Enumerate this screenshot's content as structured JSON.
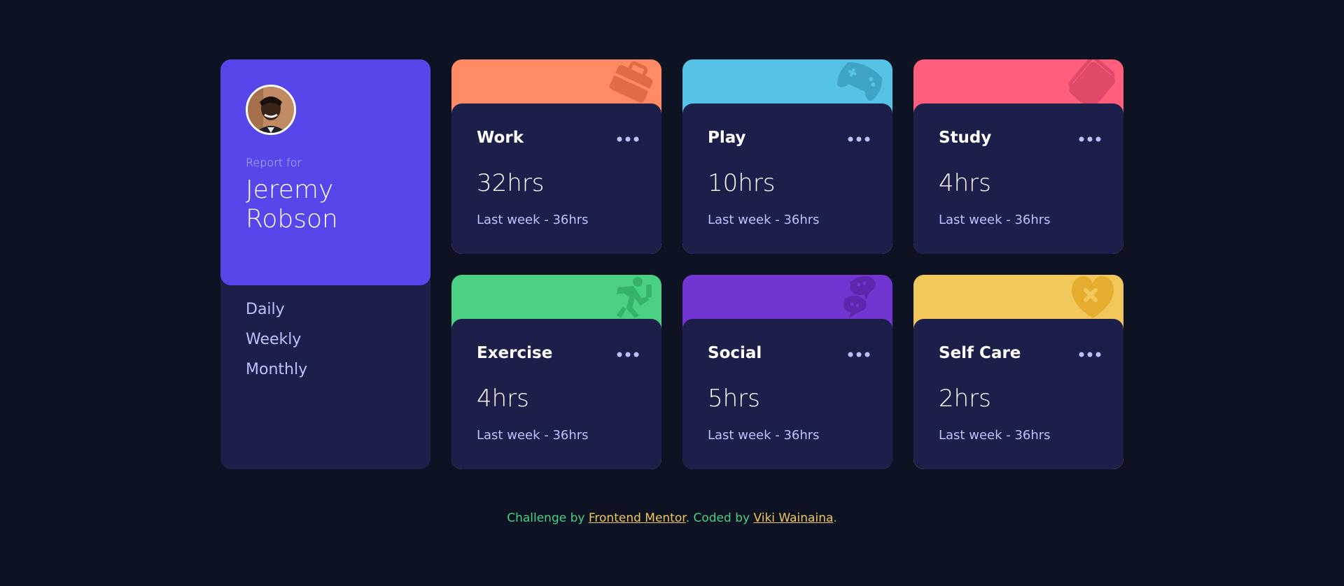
{
  "profile": {
    "report_for": "Report for",
    "name": "Jeremy Robson"
  },
  "timeframes": [
    "Daily",
    "Weekly",
    "Monthly"
  ],
  "cards": [
    {
      "title": "Work",
      "current": "32hrs",
      "previous": "Last week - 36hrs",
      "color": "#ff8b64",
      "icon": "briefcase-icon"
    },
    {
      "title": "Play",
      "current": "10hrs",
      "previous": "Last week - 36hrs",
      "color": "#55c2e6",
      "icon": "gamepad-icon"
    },
    {
      "title": "Study",
      "current": "4hrs",
      "previous": "Last week - 36hrs",
      "color": "#ff5e7d",
      "icon": "book-icon"
    },
    {
      "title": "Exercise",
      "current": "4hrs",
      "previous": "Last week - 36hrs",
      "color": "#4bcf82",
      "icon": "running-person-icon"
    },
    {
      "title": "Social",
      "current": "5hrs",
      "previous": "Last week - 36hrs",
      "color": "#7335d2",
      "icon": "chat-bubbles-icon"
    },
    {
      "title": "Self Care",
      "current": "2hrs",
      "previous": "Last week - 36hrs",
      "color": "#f1c75b",
      "icon": "heart-icon"
    }
  ],
  "footer": {
    "challenge_by": "Challenge by",
    "frontend_mentor": "Frontend Mentor",
    "coded_by": ". Coded by",
    "author": "Viki Wainaina",
    "period": "."
  },
  "colors": {
    "background": "#0e1323",
    "card_body": "#1c1f4a",
    "profile_accent": "#5747ea",
    "muted_text": "#bdc1ff"
  }
}
